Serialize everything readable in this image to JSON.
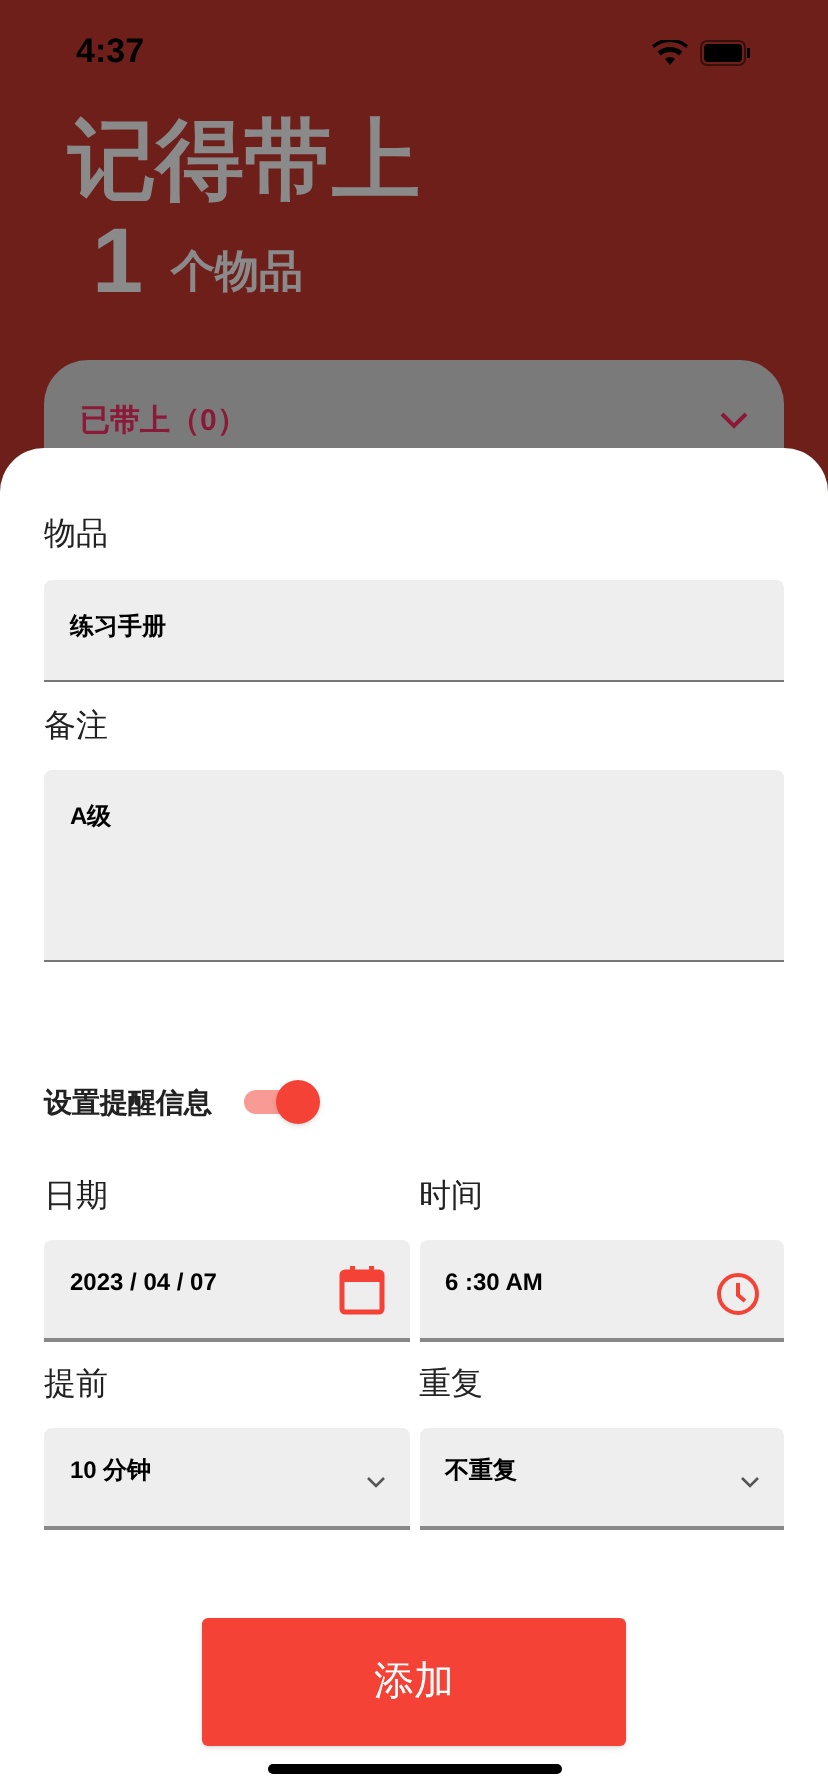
{
  "status_bar": {
    "time": "4:37"
  },
  "header": {
    "title": "记得带上",
    "count": "1",
    "count_label": "个物品"
  },
  "packed_card": {
    "title": "已带上（0）",
    "expanded": false
  },
  "form": {
    "item": {
      "label": "物品",
      "value": "练习手册"
    },
    "note": {
      "label": "备注",
      "value": "A级"
    },
    "reminder": {
      "label": "设置提醒信息",
      "on": true
    },
    "fields": [
      {
        "kind": "date",
        "label": "日期",
        "value": "2023 / 04 / 07"
      },
      {
        "kind": "time",
        "label": "时间",
        "value": "6 :30 AM"
      },
      {
        "kind": "select",
        "label": "提前",
        "value": "10 分钟"
      },
      {
        "kind": "select",
        "label": "重复",
        "value": "不重复"
      }
    ],
    "submit": "添加"
  }
}
